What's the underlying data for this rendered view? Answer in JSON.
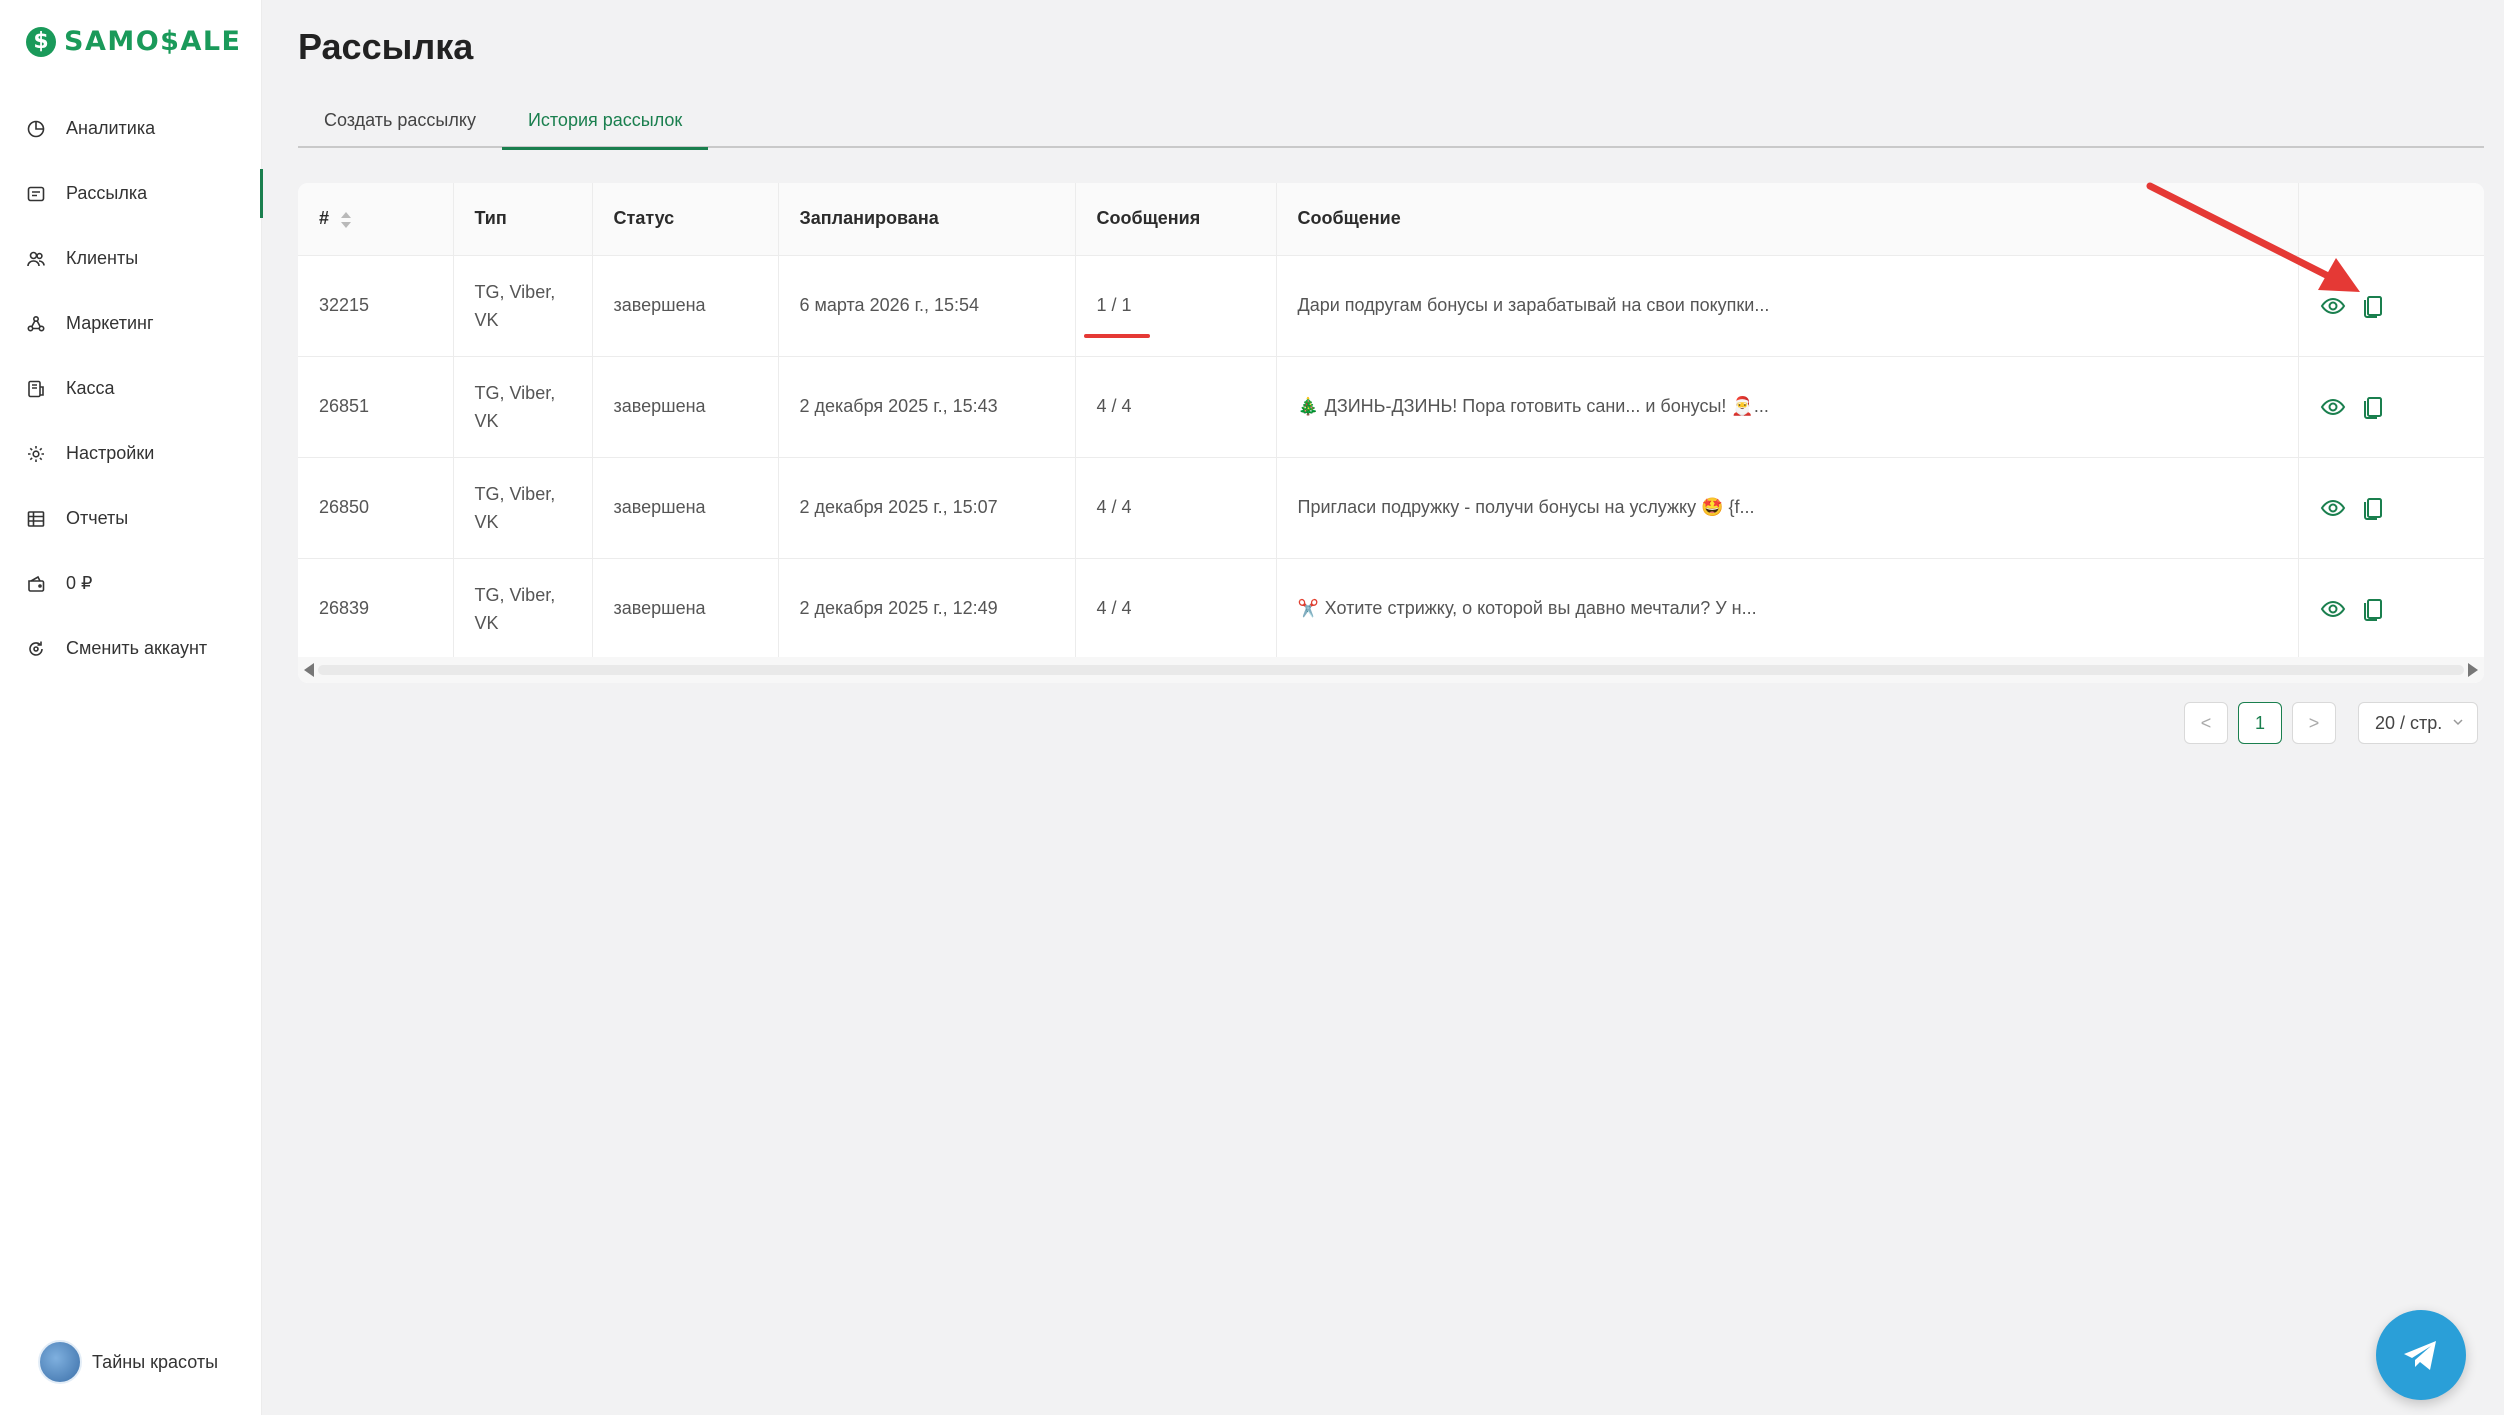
{
  "brand": {
    "name": "SAMO$ALE",
    "badge": "$",
    "color": "#1a9a5a"
  },
  "sidebar": {
    "items": [
      {
        "label": "Аналитика",
        "icon": "pie-chart-icon"
      },
      {
        "label": "Рассылка",
        "icon": "mail-icon",
        "active": true
      },
      {
        "label": "Клиенты",
        "icon": "users-icon"
      },
      {
        "label": "Маркетинг",
        "icon": "marketing-icon"
      },
      {
        "label": "Касса",
        "icon": "cash-register-icon"
      },
      {
        "label": "Настройки",
        "icon": "gear-icon"
      },
      {
        "label": "Отчеты",
        "icon": "table-icon"
      },
      {
        "label": "0 ₽",
        "icon": "wallet-icon"
      },
      {
        "label": "Сменить аккаунт",
        "icon": "switch-account-icon"
      }
    ],
    "account": {
      "name": "Тайны красоты",
      "avatar_text": "Тайны красоты"
    }
  },
  "page": {
    "title": "Рассылка"
  },
  "tabs": [
    {
      "label": "Создать рассылку",
      "active": false
    },
    {
      "label": "История рассылок",
      "active": true
    }
  ],
  "table": {
    "columns": [
      "#",
      "Тип",
      "Статус",
      "Запланирована",
      "Сообщения",
      "Сообщение",
      ""
    ],
    "rows": [
      {
        "id": "32215",
        "type_line1": "TG, Viber,",
        "type_line2": "VK",
        "status": "завершена",
        "scheduled": "6 марта 2026 г., 15:54",
        "messages": "1 / 1",
        "emoji": "",
        "message": "Дари подругам бонусы и зарабатывай на свои покупки..."
      },
      {
        "id": "26851",
        "type_line1": "TG, Viber,",
        "type_line2": "VK",
        "status": "завершена",
        "scheduled": "2 декабря 2025 г., 15:43",
        "messages": "4 / 4",
        "emoji": "🎄",
        "message": "ДЗИНЬ-ДЗИНЬ! Пора готовить сани... и бонусы! 🎅..."
      },
      {
        "id": "26850",
        "type_line1": "TG, Viber,",
        "type_line2": "VK",
        "status": "завершена",
        "scheduled": "2 декабря 2025 г., 15:07",
        "messages": "4 / 4",
        "emoji": "",
        "message": "Пригласи подружку - получи бонусы на услужку 🤩 {f..."
      },
      {
        "id": "26839",
        "type_line1": "TG, Viber,",
        "type_line2": "VK",
        "status": "завершена",
        "scheduled": "2 декабря 2025 г., 12:49",
        "messages": "4 / 4",
        "emoji": "✂️",
        "message": "Хотите стрижку, о которой вы давно мечтали? У н..."
      }
    ],
    "row_actions": [
      "eye-icon",
      "copy-icon"
    ]
  },
  "pagination": {
    "prev": "<",
    "current": "1",
    "next": ">",
    "page_size": "20 / стр."
  },
  "colors": {
    "accent": "#1a7f4e",
    "annotation": "#e53935",
    "telegram": "#2a9fd8"
  }
}
